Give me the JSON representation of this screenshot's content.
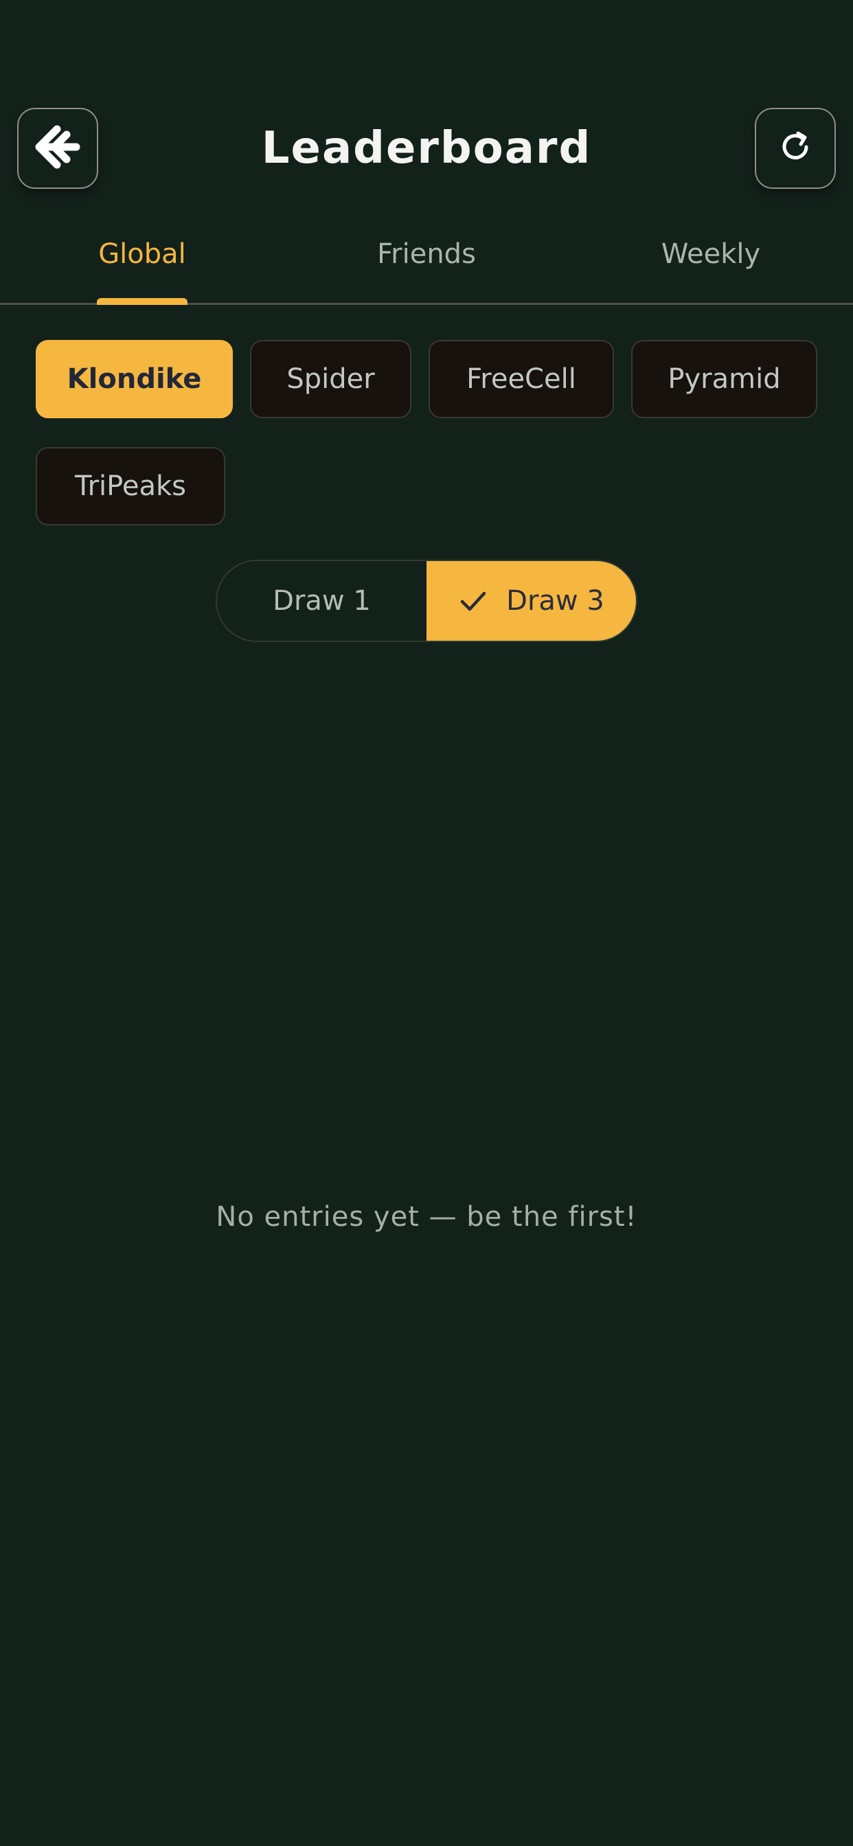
{
  "header": {
    "title": "Leaderboard",
    "back_icon": "back-arrow-icon",
    "refresh_icon": "refresh-icon"
  },
  "tabs": [
    {
      "label": "Global",
      "active": true
    },
    {
      "label": "Friends",
      "active": false
    },
    {
      "label": "Weekly",
      "active": false
    }
  ],
  "games": [
    {
      "label": "Klondike",
      "selected": true
    },
    {
      "label": "Spider",
      "selected": false
    },
    {
      "label": "FreeCell",
      "selected": false
    },
    {
      "label": "Pyramid",
      "selected": false
    },
    {
      "label": "TriPeaks",
      "selected": false
    }
  ],
  "draw_mode": {
    "options": [
      {
        "label": "Draw 1",
        "selected": false
      },
      {
        "label": "Draw 3",
        "selected": true
      }
    ],
    "check_icon": "check-icon"
  },
  "empty_state": "No entries yet — be the first!",
  "colors": {
    "background": "#13211b",
    "accent": "#f5b740",
    "chip_background": "#17120e",
    "muted_text": "#a9b5ad"
  }
}
